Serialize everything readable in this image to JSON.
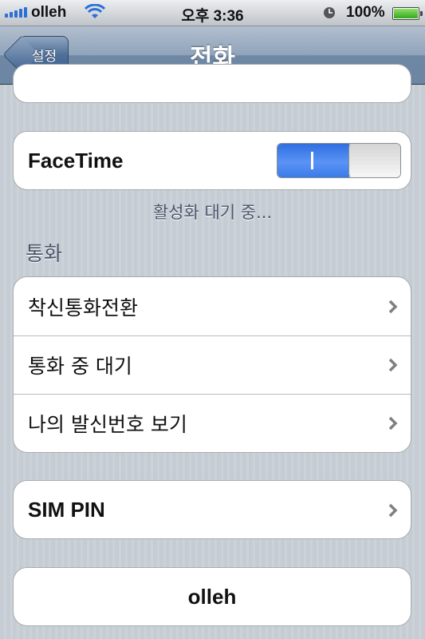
{
  "status_bar": {
    "carrier": "olleh",
    "time": "오후 3:36",
    "battery": "100%"
  },
  "nav": {
    "back": "설정",
    "title": "전화"
  },
  "facetime": {
    "label": "FaceTime",
    "toggle_on": true,
    "status": "활성화 대기 중..."
  },
  "calls_section": {
    "header": "통화",
    "items": [
      {
        "label": "착신통화전환"
      },
      {
        "label": "통화 중 대기"
      },
      {
        "label": "나의 발신번호 보기"
      }
    ]
  },
  "sim": {
    "label": "SIM PIN"
  },
  "carrier_button": {
    "label": "olleh"
  },
  "colors": {
    "accent_blue": "#2f6fe0",
    "nav_bar": "#6e87a4",
    "group_header": "#4c566c"
  }
}
